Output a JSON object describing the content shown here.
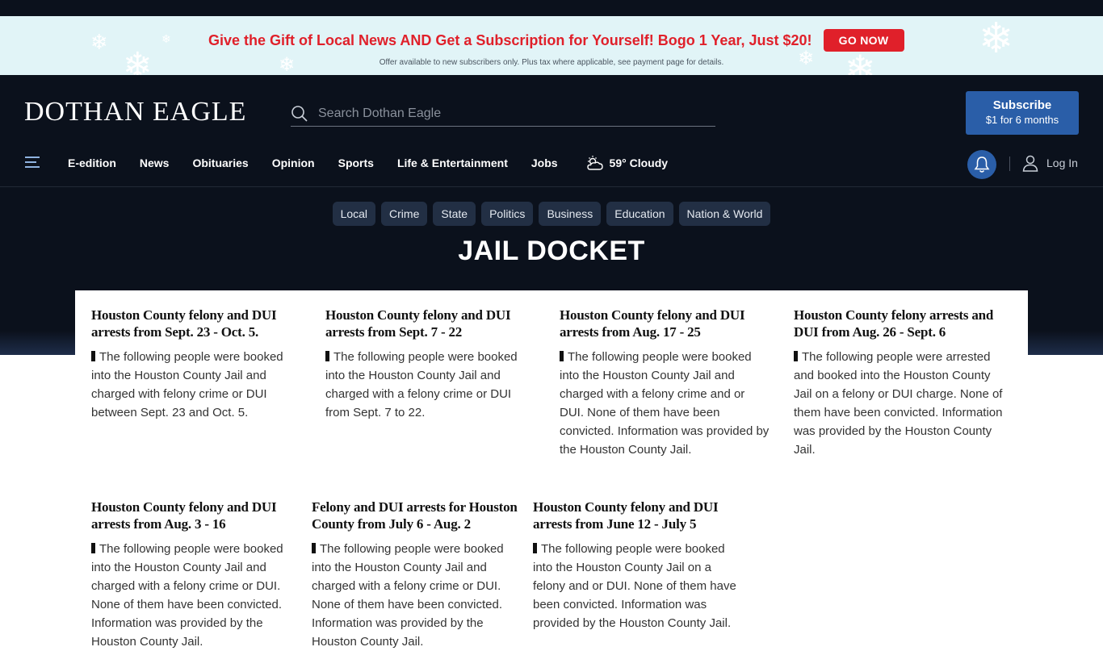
{
  "promo": {
    "headline": "Give the Gift of Local News AND Get a Subscription for Yourself! Bogo 1 Year, Just $20!",
    "button_label": "GO NOW",
    "fine_print": "Offer available to new subscribers only. Plus tax where applicable, see payment page for details."
  },
  "header": {
    "logo_text": "DOTHAN EAGLE",
    "search_placeholder": "Search Dothan Eagle",
    "subscribe_label": "Subscribe",
    "subscribe_offer": "$1 for 6 months",
    "login_label": "Log In",
    "nav_items": [
      "E-edition",
      "News",
      "Obituaries",
      "Opinion",
      "Sports",
      "Life & Entertainment",
      "Jobs"
    ],
    "weather": "59° Cloudy"
  },
  "section": {
    "pills": [
      "Local",
      "Crime",
      "State",
      "Politics",
      "Business",
      "Education",
      "Nation & World"
    ],
    "title": "JAIL DOCKET"
  },
  "articles": [
    {
      "headline": "Houston County felony and DUI arrests from Sept. 23 - Oct. 5.",
      "summary": "The following people were booked into the Houston County Jail and charged with felony crime or DUI between Sept. 23 and Oct. 5."
    },
    {
      "headline": "Houston County felony and DUI arrests from Sept. 7 - 22",
      "summary": "The following people were booked into the Houston County Jail and charged with a felony crime or DUI from Sept. 7 to 22."
    },
    {
      "headline": "Houston County felony and DUI arrests from Aug. 17 - 25",
      "summary": "The following people were booked into the Houston County Jail and charged with a felony crime and or DUI. None of them have been convicted. Information was provided by the Houston County Jail."
    },
    {
      "headline": "Houston County felony arrests and DUI from Aug. 26 - Sept. 6",
      "summary": "The following people were arrested and booked into the Houston County Jail on a felony or DUI charge. None of them have been convicted. Information was provided by the Houston County Jail."
    },
    {
      "headline": "Houston County felony and DUI arrests from Aug. 3 - 16",
      "summary": "The following people were booked into the Houston County Jail and charged with a felony crime or DUI. None of them have been convicted. Information was provided by the Houston County Jail."
    },
    {
      "headline": "Felony and DUI arrests for Houston County from July 6 - Aug. 2",
      "summary": "The following people were booked into the Houston County Jail and charged with a felony crime or DUI. None of them have been convicted. Information was provided by the Houston County Jail."
    },
    {
      "headline": "Houston County felony and DUI arrests from June 12 - July 5",
      "summary": "The following people were booked into the Houston County Jail on a felony and or DUI. None of them have been convicted. Information was provided by the Houston County Jail."
    }
  ],
  "colors": {
    "promo_bg": "#e1f4f7",
    "promo_red": "#e0202a",
    "header_bg": "#0b111c",
    "accent_blue": "#2a5ea8",
    "pill_bg": "#222f44"
  }
}
